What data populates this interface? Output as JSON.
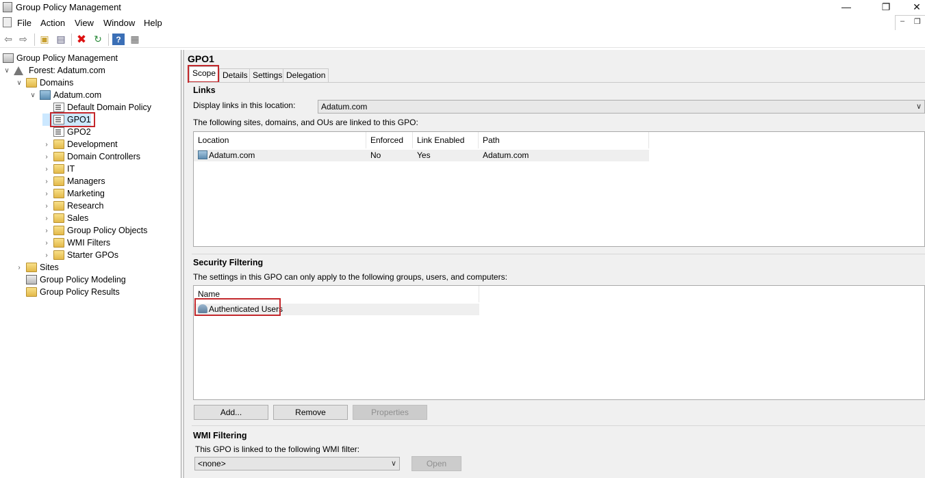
{
  "window": {
    "title": "Group Policy Management"
  },
  "menu": [
    "File",
    "Action",
    "View",
    "Window",
    "Help"
  ],
  "toolbar": {
    "buttons": [
      "back-icon",
      "forward-icon",
      "up-folder-icon",
      "show-hide-tree-icon",
      "delete-icon",
      "refresh-icon",
      "help-icon",
      "properties-icon"
    ]
  },
  "tree": {
    "root": "Group Policy Management",
    "forest": "Forest: Adatum.com",
    "domains": "Domains",
    "domain": "Adatum.com",
    "children": [
      "Default Domain Policy",
      "GPO1",
      "GPO2",
      "Development",
      "Domain Controllers",
      "IT",
      "Managers",
      "Marketing",
      "Research",
      "Sales",
      "Group Policy Objects",
      "WMI Filters",
      "Starter GPOs"
    ],
    "sites": "Sites",
    "modeling": "Group Policy Modeling",
    "results": "Group Policy Results"
  },
  "gpo": {
    "title": "GPO1",
    "tabs": [
      "Scope",
      "Details",
      "Settings",
      "Delegation"
    ],
    "links": {
      "title": "Links",
      "display_label": "Display links in this location:",
      "display_value": "Adatum.com",
      "desc": "The following sites, domains, and OUs are linked to this GPO:",
      "columns": [
        "Location",
        "Enforced",
        "Link Enabled",
        "Path"
      ],
      "rows": [
        {
          "location": "Adatum.com",
          "enforced": "No",
          "link_enabled": "Yes",
          "path": "Adatum.com"
        }
      ]
    },
    "security": {
      "title": "Security Filtering",
      "desc": "The settings in this GPO can only apply to the following groups, users, and computers:",
      "column": "Name",
      "rows": [
        "Authenticated Users"
      ],
      "add": "Add...",
      "remove": "Remove",
      "properties": "Properties"
    },
    "wmi": {
      "title": "WMI Filtering",
      "desc": "This GPO is linked to the following WMI filter:",
      "value": "<none>",
      "open": "Open"
    }
  },
  "colors": {
    "highlight": "#c3272b",
    "pane_bg": "#f0f0f0",
    "disabled_btn": "#cccccc"
  }
}
